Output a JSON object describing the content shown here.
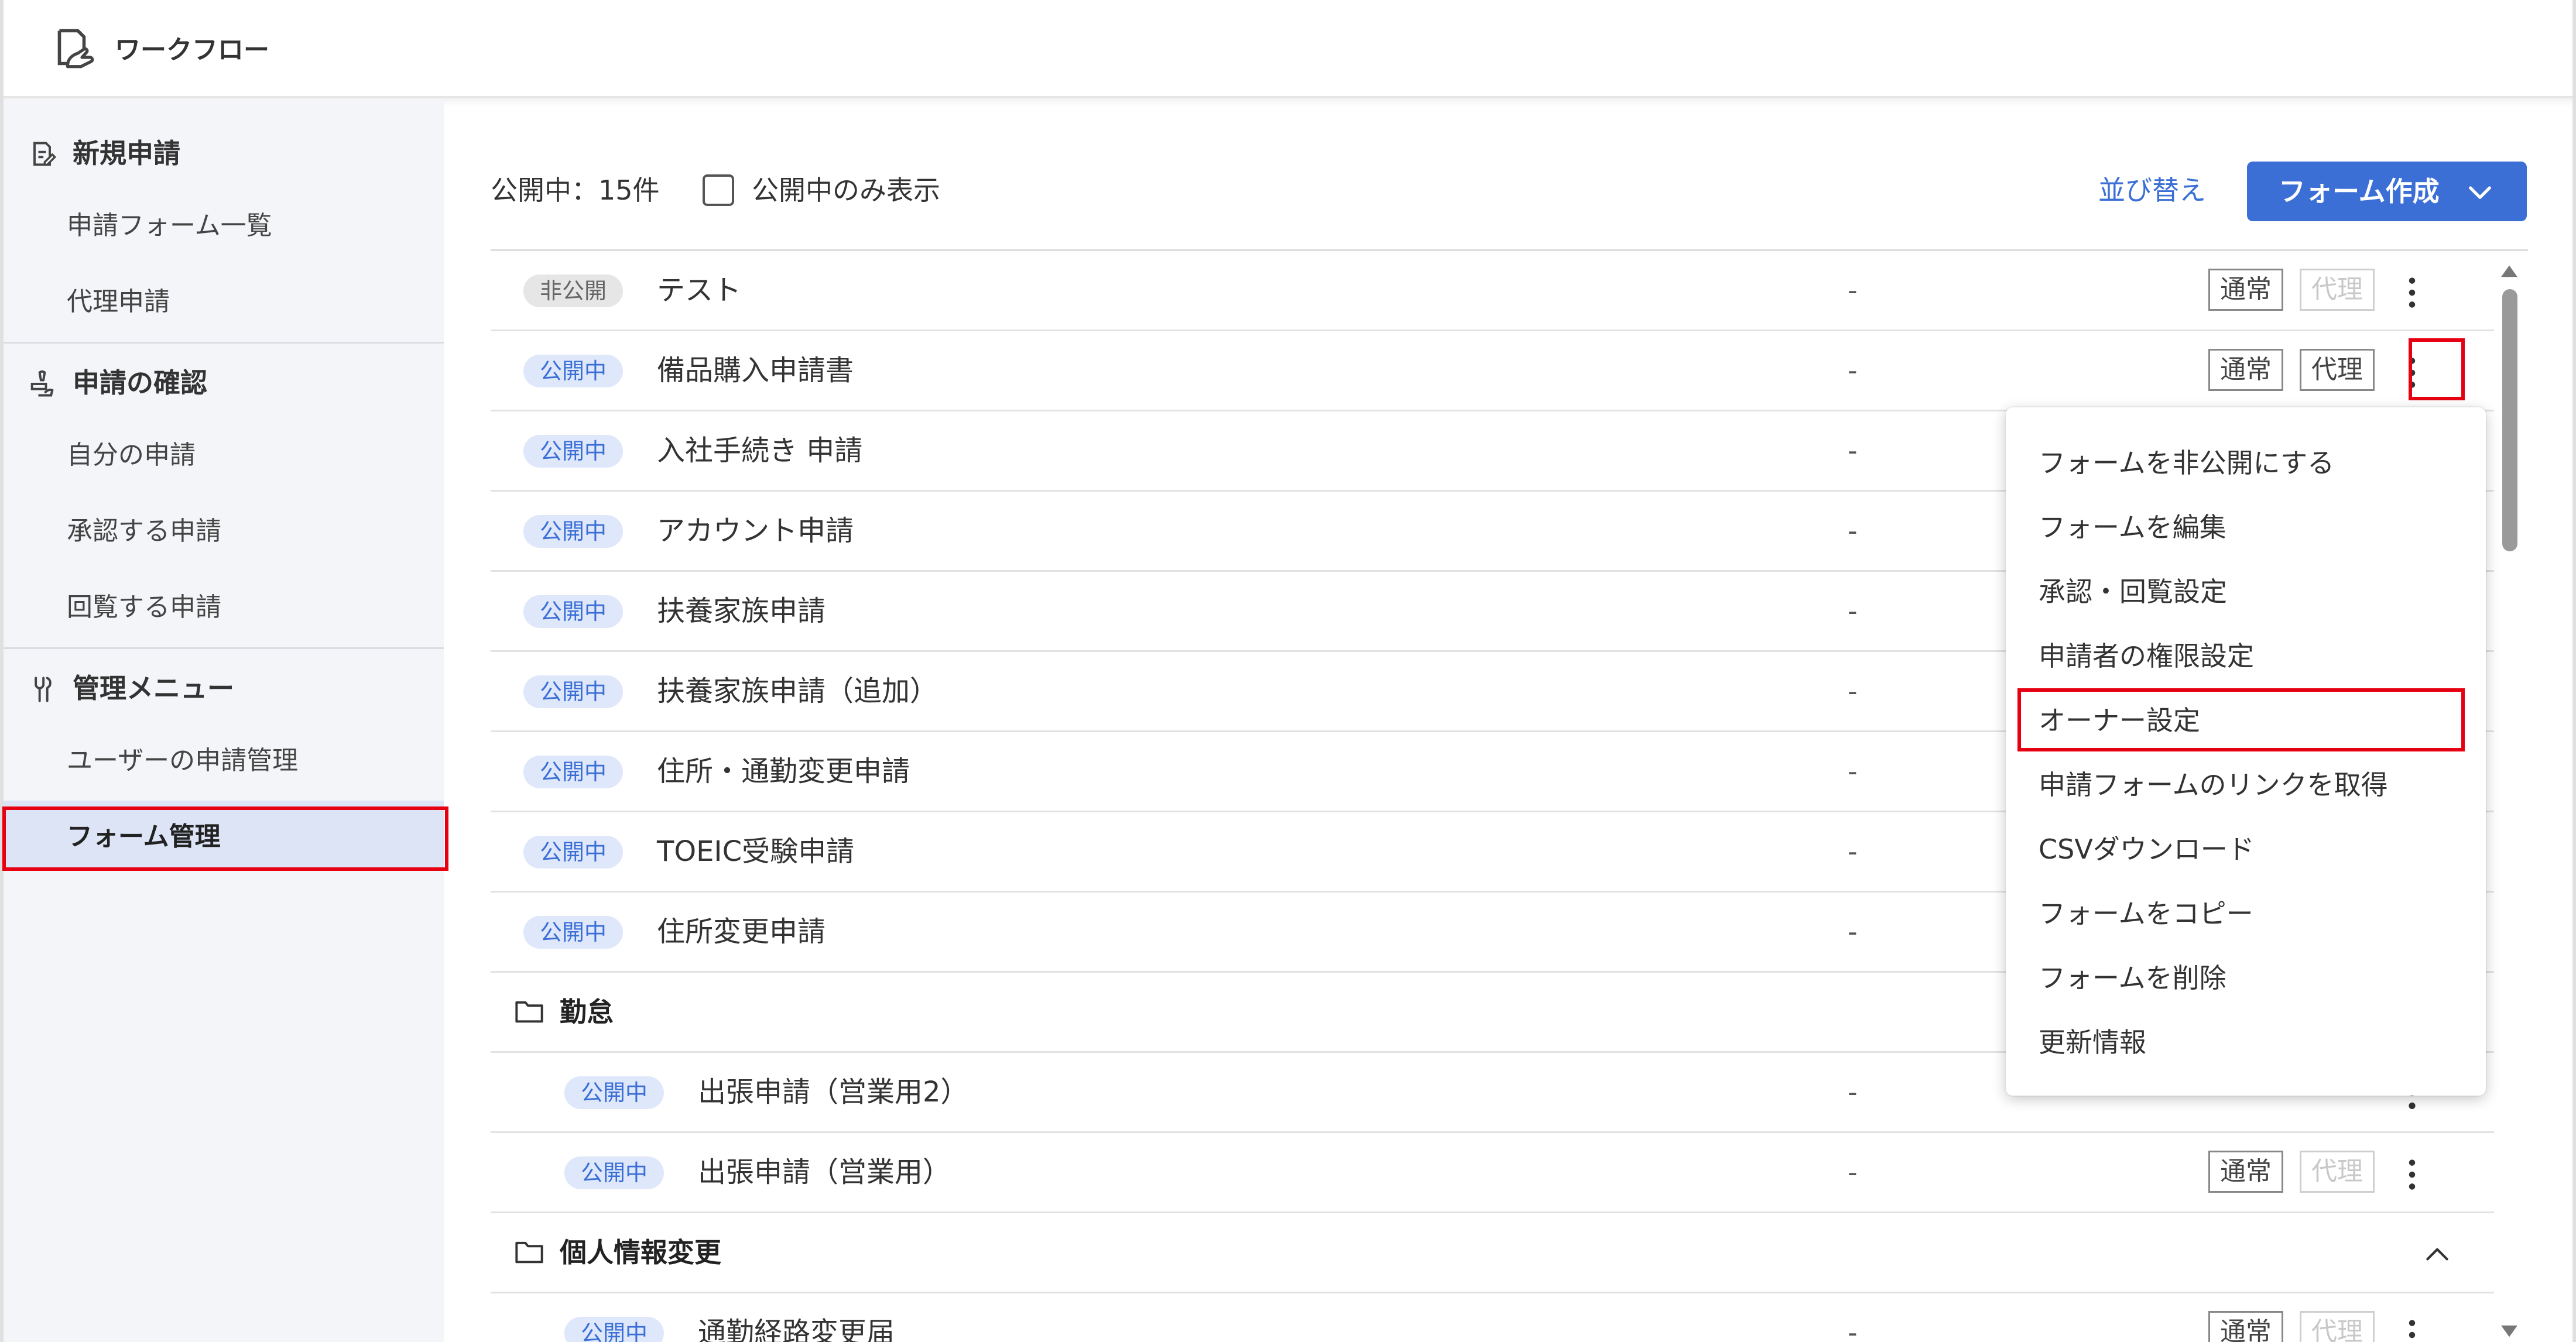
{
  "header": {
    "title": "ワークフロー",
    "logo_icon": "workflow-hand-icon"
  },
  "sidebar": {
    "sections": [
      {
        "label": "新規申請",
        "icon": "edit-note-icon",
        "items": [
          "申請フォーム一覧",
          "代理申請"
        ]
      },
      {
        "label": "申請の確認",
        "icon": "stamp-hand-icon",
        "items": [
          "自分の申請",
          "承認する申請",
          "回覧する申請"
        ]
      },
      {
        "label": "管理メニュー",
        "icon": "tools-icon",
        "items": [
          "ユーザーの申請管理",
          "フォーム管理"
        ]
      }
    ],
    "active_item": "フォーム管理"
  },
  "toolbar": {
    "count_label": "公開中：15件",
    "public_only_label": "公開中のみ表示",
    "public_only_checked": false,
    "sort_label": "並び替え",
    "create_label": "フォーム作成"
  },
  "tag_labels": {
    "normal": "通常",
    "proxy": "代理"
  },
  "rows": [
    {
      "status": "非公開",
      "name": "テスト",
      "value": "-",
      "proxy_enabled": false
    },
    {
      "status": "公開中",
      "name": "備品購入申請書",
      "value": "-",
      "proxy_enabled": true
    },
    {
      "status": "公開中",
      "name": "入社手続き 申請",
      "value": "-"
    },
    {
      "status": "公開中",
      "name": "アカウント申請",
      "value": "-"
    },
    {
      "status": "公開中",
      "name": "扶養家族申請",
      "value": "-"
    },
    {
      "status": "公開中",
      "name": "扶養家族申請（追加）",
      "value": "-"
    },
    {
      "status": "公開中",
      "name": "住所・通勤変更申請",
      "value": "-"
    },
    {
      "status": "公開中",
      "name": "TOEIC受験申請",
      "value": "-"
    },
    {
      "status": "公開中",
      "name": "住所変更申請",
      "value": "-"
    }
  ],
  "folder1": {
    "name": "勤怠",
    "rows": [
      {
        "status": "公開中",
        "name": "出張申請（営業用2）",
        "value": "-",
        "normal_label": "通常",
        "proxy_label": "代理"
      },
      {
        "status": "公開中",
        "name": "出張申請（営業用）",
        "value": "-",
        "proxy_enabled": false
      }
    ]
  },
  "folder2": {
    "name": "個人情報変更",
    "rows": [
      {
        "status": "公開中",
        "name": "通勤経路変更届",
        "value": "-"
      }
    ]
  },
  "menu": {
    "items": [
      "フォームを非公開にする",
      "フォームを編集",
      "承認・回覧設定",
      "申請者の権限設定",
      "オーナー設定",
      "申請フォームのリンクを取得",
      "CSVダウンロード",
      "フォームをコピー",
      "フォームを削除",
      "更新情報"
    ],
    "highlighted": "オーナー設定"
  },
  "colors": {
    "accent": "#3b6fd6",
    "highlight": "#e60012",
    "badge_public_bg": "#dfe8fa",
    "badge_private_bg": "#e6e6e6",
    "sidebar_bg": "#f3f5f8",
    "sidebar_active_bg": "#dce4f6"
  }
}
